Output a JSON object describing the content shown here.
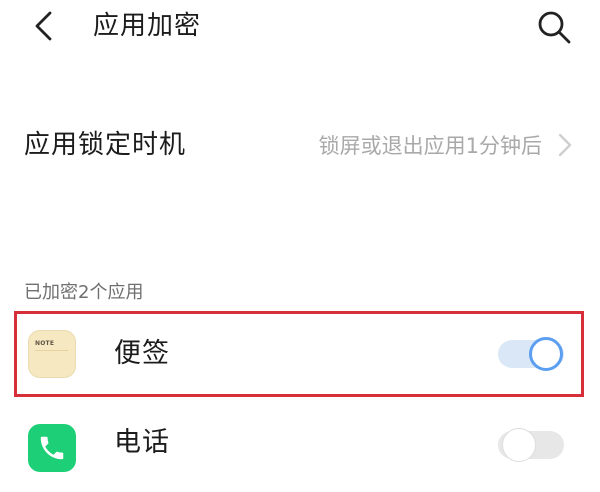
{
  "header": {
    "title": "应用加密",
    "back_icon": "chevron-left-icon",
    "search_icon": "search-icon"
  },
  "lock_timing": {
    "label": "应用锁定时机",
    "value": "锁屏或退出应用1分钟后",
    "chevron_icon": "chevron-right-icon"
  },
  "encrypted_apps": {
    "section_title": "已加密2个应用",
    "items": [
      {
        "name": "便签",
        "icon": "notes-app-icon",
        "icon_text": "NOTE",
        "enabled": true,
        "highlighted": true
      },
      {
        "name": "电话",
        "icon": "phone-app-icon",
        "enabled": false,
        "highlighted": false
      }
    ]
  },
  "colors": {
    "highlight_border": "#d72f3a",
    "toggle_accent": "#5c9ff0",
    "secondary_text": "#a9a9a9",
    "phone_icon": "#1dcf76",
    "notes_icon": "#f6e9c2"
  }
}
